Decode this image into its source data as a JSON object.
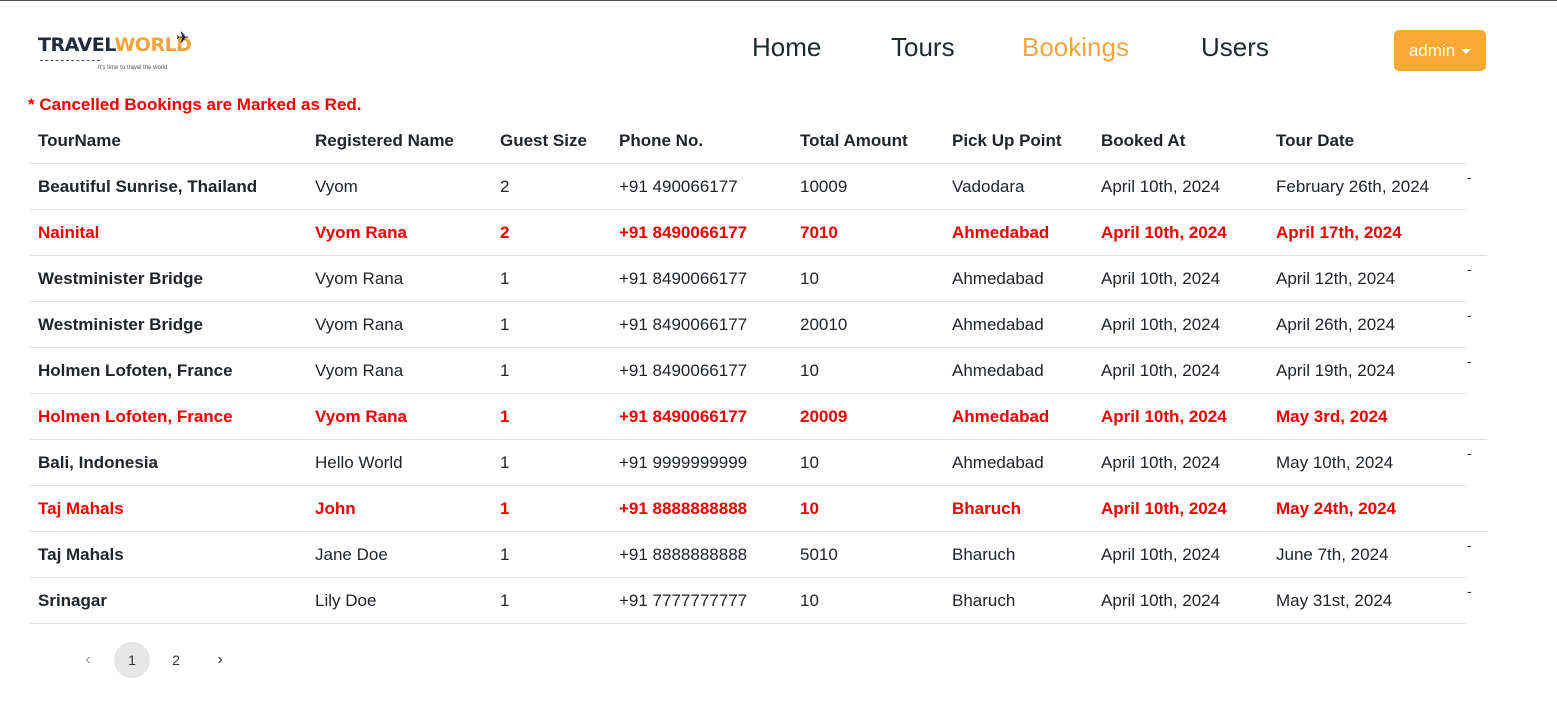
{
  "brand": {
    "logo_text_1": "TRAVEL",
    "logo_text_2": "WORLD",
    "tagline": "It's time to travel the world"
  },
  "nav": {
    "items": [
      {
        "label": "Home",
        "active": false
      },
      {
        "label": "Tours",
        "active": false
      },
      {
        "label": "Bookings",
        "active": true
      },
      {
        "label": "Users",
        "active": false
      }
    ]
  },
  "user_menu": {
    "label": "admin"
  },
  "notice": "* Cancelled Bookings are Marked as Red.",
  "table": {
    "headers": [
      "TourName",
      "Registered Name",
      "Guest Size",
      "Phone No.",
      "Total Amount",
      "Pick Up Point",
      "Booked At",
      "Tour Date"
    ],
    "rows": [
      {
        "cancelled": false,
        "cells": [
          "Beautiful Sunrise, Thailand",
          "Vyom",
          "2",
          "+91 490066177",
          "10009",
          "Vadodara",
          "April 10th, 2024",
          "February 26th, 2024"
        ]
      },
      {
        "cancelled": true,
        "cells": [
          "Nainital",
          "Vyom Rana",
          "2",
          "+91 8490066177",
          "7010",
          "Ahmedabad",
          "April 10th, 2024",
          "April 17th, 2024"
        ]
      },
      {
        "cancelled": false,
        "cells": [
          "Westminister Bridge",
          "Vyom Rana",
          "1",
          "+91 8490066177",
          "10",
          "Ahmedabad",
          "April 10th, 2024",
          "April 12th, 2024"
        ]
      },
      {
        "cancelled": false,
        "cells": [
          "Westminister Bridge",
          "Vyom Rana",
          "1",
          "+91 8490066177",
          "20010",
          "Ahmedabad",
          "April 10th, 2024",
          "April 26th, 2024"
        ]
      },
      {
        "cancelled": false,
        "cells": [
          "Holmen Lofoten, France",
          "Vyom Rana",
          "1",
          "+91 8490066177",
          "10",
          "Ahmedabad",
          "April 10th, 2024",
          "April 19th, 2024"
        ]
      },
      {
        "cancelled": true,
        "cells": [
          "Holmen Lofoten, France",
          "Vyom Rana",
          "1",
          "+91 8490066177",
          "20009",
          "Ahmedabad",
          "April 10th, 2024",
          "May 3rd, 2024"
        ]
      },
      {
        "cancelled": false,
        "cells": [
          "Bali, Indonesia",
          "Hello World",
          "1",
          "+91 9999999999",
          "10",
          "Ahmedabad",
          "April 10th, 2024",
          "May 10th, 2024"
        ]
      },
      {
        "cancelled": true,
        "cells": [
          "Taj Mahals",
          "John",
          "1",
          "+91 8888888888",
          "10",
          "Bharuch",
          "April 10th, 2024",
          "May 24th, 2024"
        ]
      },
      {
        "cancelled": false,
        "cells": [
          "Taj Mahals",
          "Jane Doe",
          "1",
          "+91 8888888888",
          "5010",
          "Bharuch",
          "April 10th, 2024",
          "June 7th, 2024"
        ]
      },
      {
        "cancelled": false,
        "cells": [
          "Srinagar",
          "Lily Doe",
          "1",
          "+91 7777777777",
          "10",
          "Bharuch",
          "April 10th, 2024",
          "May 31st, 2024"
        ]
      }
    ],
    "row_action_glyph": "-"
  },
  "pagination": {
    "prev": "‹",
    "pages": [
      "1",
      "2"
    ],
    "current": "1",
    "next": "›"
  }
}
